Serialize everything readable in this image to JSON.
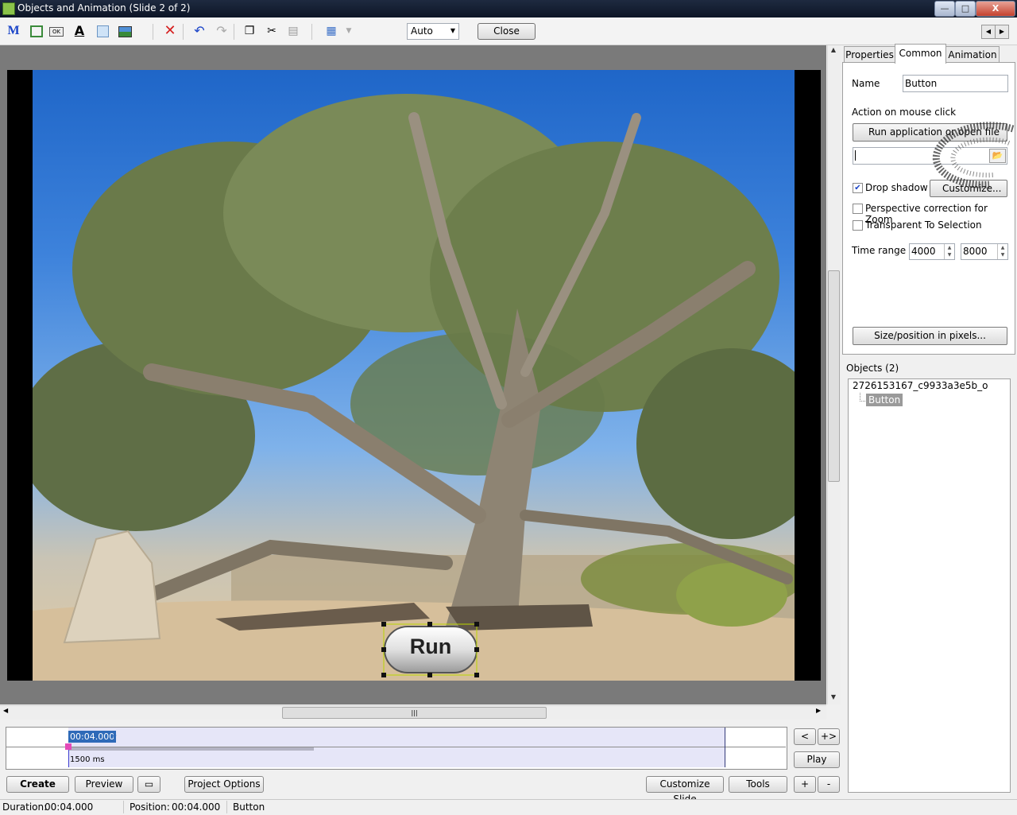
{
  "window": {
    "title": "Objects and Animation  (Slide 2 of 2)",
    "min": "—",
    "max": "□",
    "close": "X"
  },
  "toolbar": {
    "m_icon": "M",
    "text_icon": "A",
    "button_icon_text": "OK",
    "zoom_value": "Auto",
    "close_label": "Close"
  },
  "slide": {
    "button_label": "Run"
  },
  "timeline": {
    "current_time": "00:04.000",
    "duration_label": "1500 ms",
    "prev": "<",
    "next": "+>",
    "play": "Play"
  },
  "bottom": {
    "create": "Create",
    "preview": "Preview",
    "project_options": "Project Options",
    "customize_slide": "Customize Slide",
    "tools": "Tools",
    "plus": "+",
    "minus": "-"
  },
  "status": {
    "duration_label": "Duration:",
    "duration_value": "00:04.000",
    "position_label": "Position:",
    "position_value": "00:04.000",
    "selected_object": "Button"
  },
  "panel": {
    "tabs": [
      "Properties",
      "Common",
      "Animation"
    ],
    "active_tab": "Common",
    "name_label": "Name",
    "name_value": "Button",
    "action_label": "Action on mouse click",
    "action_value": "Run application or open file",
    "path_value": "",
    "drop_shadow_label": "Drop shadow",
    "drop_shadow_checked": true,
    "customize_label": "Customize...",
    "perspective_label": "Perspective correction for Zoom",
    "perspective_checked": false,
    "transparent_label": "Transparent To Selection",
    "transparent_checked": false,
    "time_range_label": "Time range",
    "time_range_start": "4000",
    "time_range_end": "8000",
    "size_position_label": "Size/position in pixels..."
  },
  "objects": {
    "header": "Objects (2)",
    "root": "2726153167_c9933a3e5b_o",
    "child": "Button"
  },
  "colors": {
    "accent": "#2e6ab8",
    "timeline_band": "#e6e6f8",
    "marker": "#e44ab8"
  }
}
